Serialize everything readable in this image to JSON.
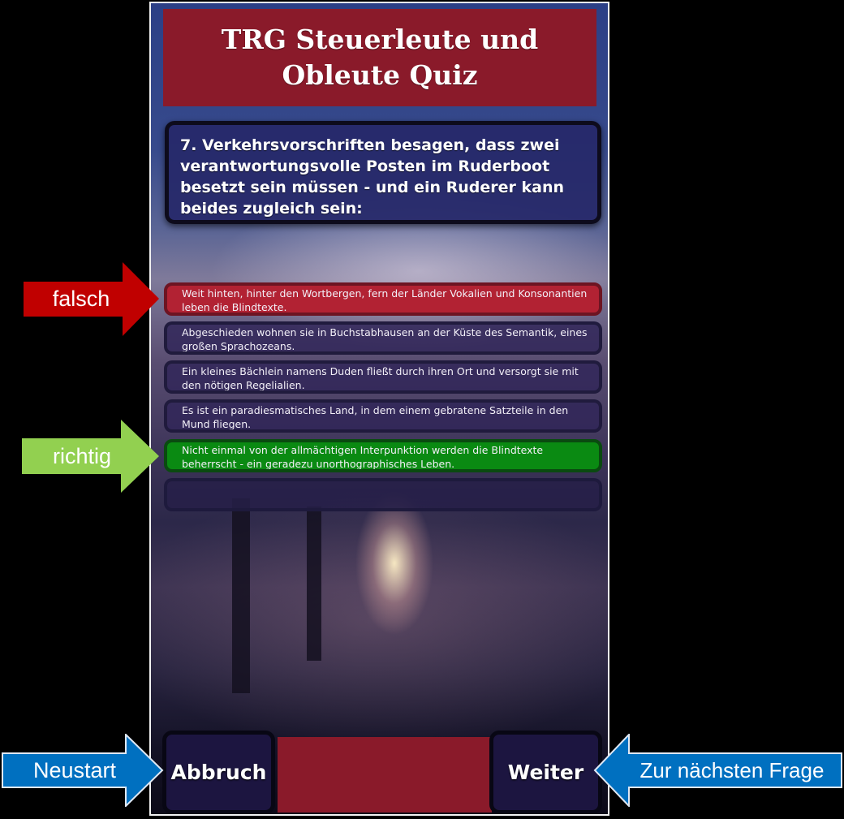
{
  "app": {
    "title": "TRG Steuerleute und Obleute Quiz"
  },
  "question": {
    "text": "7. Verkehrsvorschriften besagen, dass zwei verantwortungsvolle Posten im Ruderboot besetzt sein müssen - und ein Ruderer kann beides zugleich sein:"
  },
  "answers": [
    {
      "text": "Weit hinten, hinter den Wortbergen, fern der Länder Vokalien und Konsonantien leben die Blindtexte.",
      "state": "wrong"
    },
    {
      "text": "Abgeschieden wohnen sie in Buchstabhausen an der Küste des Semantik, eines großen Sprachozeans.",
      "state": "neutral"
    },
    {
      "text": "Ein kleines Bächlein namens Duden fließt durch ihren Ort und versorgt sie mit den nötigen Regelialien.",
      "state": "neutral"
    },
    {
      "text": "Es ist ein paradiesmatisches Land, in dem einem gebratene Satzteile in den Mund fliegen.",
      "state": "neutral"
    },
    {
      "text": "Nicht einmal von der allmächtigen Interpunktion werden die Blindtexte beherrscht - ein geradezu unorthographisches Leben.",
      "state": "correct"
    },
    {
      "text": "",
      "state": "empty"
    }
  ],
  "buttons": {
    "cancel_label": "Abbruch",
    "next_label": "Weiter"
  },
  "annotations": {
    "wrong_label": "falsch",
    "right_label": "richtig",
    "restart_label": "Neustart",
    "next_question_label": "Zur nächsten Frage"
  },
  "colors": {
    "title_bar": "#8a1a2a",
    "wrong_answer": "#b22233",
    "correct_answer": "#0a8a12",
    "wrong_arrow": "#c00000",
    "right_arrow": "#92d050",
    "blue_arrow": "#0070c0"
  }
}
